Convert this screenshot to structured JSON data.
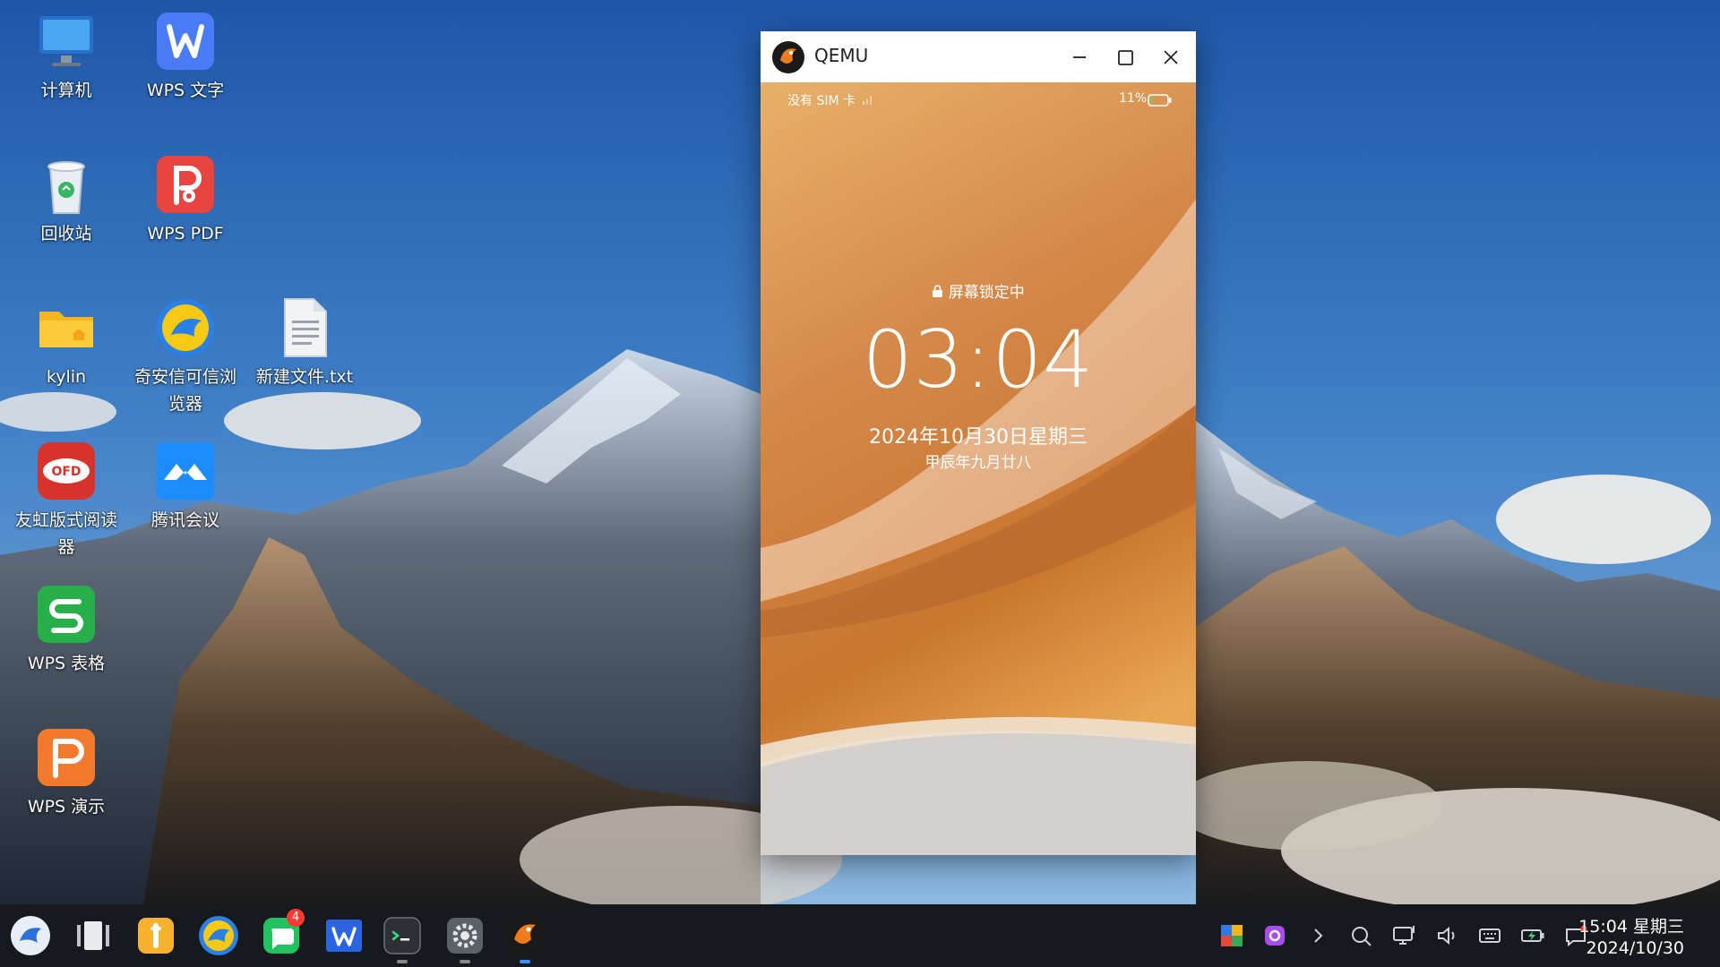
{
  "desktop": {
    "icons": [
      {
        "label": "计算机"
      },
      {
        "label": "WPS 文字"
      },
      {
        "label": "回收站"
      },
      {
        "label": "WPS PDF"
      },
      {
        "label": "kylin"
      },
      {
        "label": "奇安信可信浏览器"
      },
      {
        "label": "新建文件.txt"
      },
      {
        "label": "友虹版式阅读器"
      },
      {
        "label": "腾讯会议"
      },
      {
        "label": "WPS 表格"
      },
      {
        "label": "WPS 演示"
      }
    ],
    "ofd_text": "OFD"
  },
  "window": {
    "title": "QEMU",
    "phone": {
      "carrier": "没有 SIM 卡",
      "battery": "11%",
      "battery_level": 0.11,
      "lock_status": "屏幕锁定中",
      "time": "03:04",
      "date": "2024年10月30日星期三",
      "lunar": "甲辰年九月廿八"
    }
  },
  "taskbar": {
    "apps": [
      {
        "name": "start-menu"
      },
      {
        "name": "multitask-view"
      },
      {
        "name": "file-manager"
      },
      {
        "name": "qianxin-browser"
      },
      {
        "name": "messages",
        "badge": "4"
      },
      {
        "name": "wps-writer"
      },
      {
        "name": "terminal"
      },
      {
        "name": "settings"
      },
      {
        "name": "qemu"
      }
    ],
    "clock": {
      "time": "15:04 星期三",
      "date": "2024/10/30"
    }
  },
  "colors": {
    "taskbar": "#16191d",
    "active_indicator": "#3b8fff",
    "badge": "#ff3b30"
  }
}
